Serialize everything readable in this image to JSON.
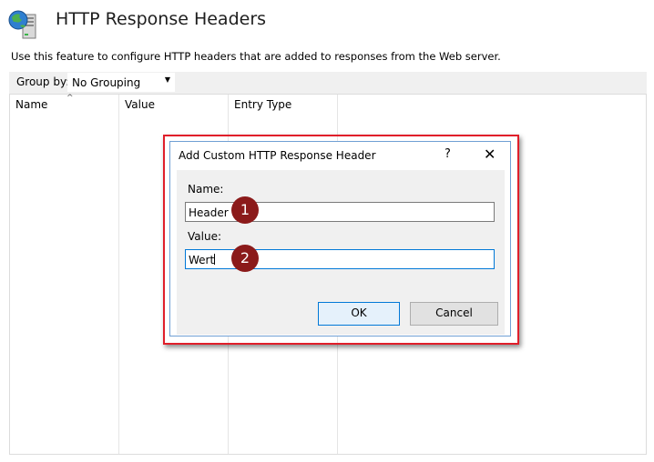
{
  "header": {
    "title": "HTTP Response Headers",
    "description": "Use this feature to configure HTTP headers that are added to responses from the Web server."
  },
  "toolbar": {
    "group_by_label": "Group by:",
    "group_by_value": "No Grouping"
  },
  "list": {
    "columns": [
      "Name",
      "Value",
      "Entry Type"
    ]
  },
  "dialog": {
    "title": "Add Custom HTTP Response Header",
    "help_glyph": "?",
    "close_glyph": "✕",
    "name_label": "Name:",
    "name_value": "Header",
    "value_label": "Value:",
    "value_value": "Wert",
    "ok_label": "OK",
    "cancel_label": "Cancel"
  },
  "annotations": {
    "badge1": "1",
    "badge2": "2",
    "highlight_color": "#e01e2a",
    "badge_color": "#8b1a1a"
  }
}
